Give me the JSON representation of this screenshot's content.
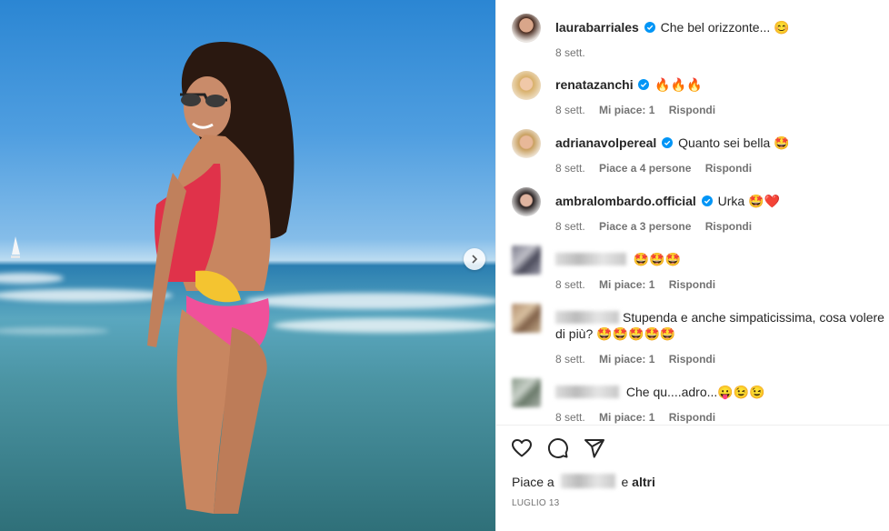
{
  "comments": [
    {
      "user": "laurabarriales",
      "verified": true,
      "text": "Che bel orizzonte... 😊",
      "date": "8 sett."
    },
    {
      "user": "renatazanchi",
      "verified": true,
      "text": "🔥🔥🔥",
      "date": "8 sett.",
      "likes": "Mi piace: 1",
      "reply": "Rispondi"
    },
    {
      "user": "adrianavolpereal",
      "verified": true,
      "text": "Quanto sei bella 🤩",
      "date": "8 sett.",
      "likes": "Piace a 4 persone",
      "reply": "Rispondi"
    },
    {
      "user": "ambralombardo.official",
      "verified": true,
      "text": "Urka 🤩❤️",
      "date": "8 sett.",
      "likes": "Piace a 3 persone",
      "reply": "Rispondi"
    },
    {
      "text": "🤩🤩🤩",
      "date": "8 sett.",
      "likes": "Mi piace: 1",
      "reply": "Rispondi"
    },
    {
      "text": "Stupenda e anche simpaticissima, cosa volere di più? 🤩🤩🤩🤩🤩",
      "date": "8 sett.",
      "likes": "Mi piace: 1",
      "reply": "Rispondi"
    },
    {
      "text": "Che qu....adro...😛😉😉",
      "date": "8 sett.",
      "likes": "Mi piace: 1",
      "reply": "Rispondi"
    }
  ],
  "actions": {
    "like_icon": "heart-icon",
    "comment_icon": "comment-icon",
    "share_icon": "send-icon"
  },
  "likes": {
    "prefix": "Piace a",
    "suffix_and": "e",
    "suffix_others": "altri"
  },
  "post_date": "LUGLIO 13",
  "colors": {
    "verified": "#0095f6",
    "text": "#262626",
    "secondary": "#737373"
  }
}
